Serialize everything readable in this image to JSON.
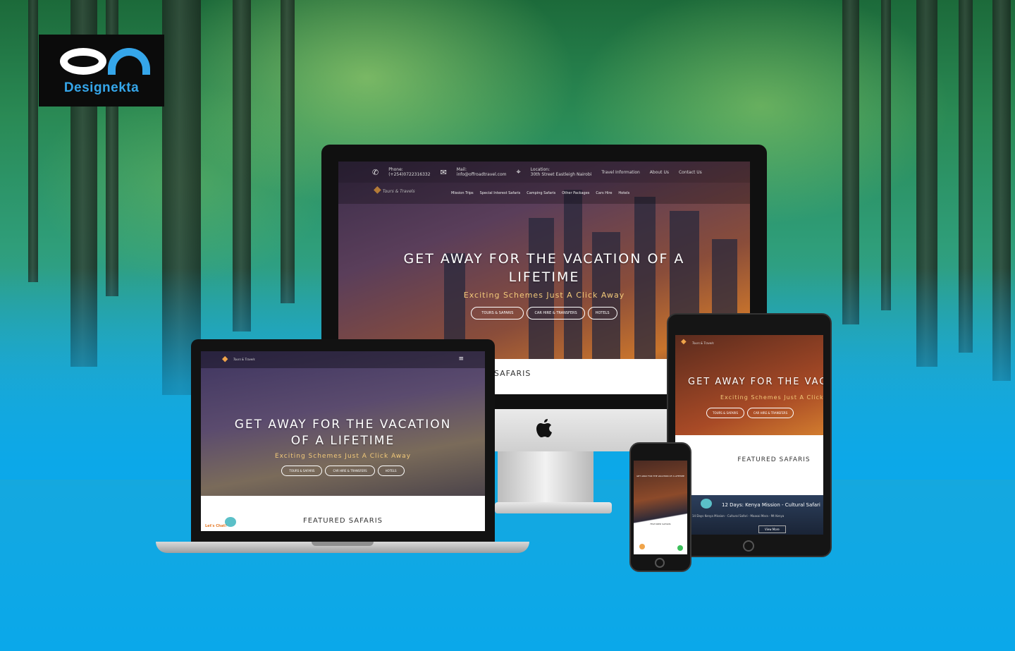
{
  "brand": {
    "logo_text": "Designekta"
  },
  "site": {
    "hero_title": "GET AWAY FOR THE VACATION OF A LIFETIME",
    "hero_subtitle": "Exciting Schemes Just A Click Away",
    "buttons": [
      "TOURS & SAFARIS",
      "CAR HIRE & TRANSFERS",
      "HOTELS"
    ],
    "section_title": "FEATURED SAFARIS",
    "contact": {
      "phone_label": "Phone:",
      "phone_value": "(+254)0722316332",
      "mail_label": "Mail:",
      "mail_value": "info@offroadtravel.com",
      "location_label": "Location:",
      "location_value": "30th Street Eastleigh Nairobi"
    },
    "top_links": [
      "Travel Information",
      "About Us",
      "Contact Us"
    ],
    "nav": [
      "Mission Trips",
      "Special Interest Safaris",
      "Camping Safaris",
      "Other Packages",
      "Cars Hire",
      "Hotels"
    ],
    "brand_tagline": "Tours & Travels",
    "chat_label": "Let's Chat!",
    "tablet_card_title": "12 Days: Kenya Mission - Cultural Safari",
    "tablet_card_sub": "14 Days Kenya Mission - Cultural Safari - Maasai Mara - Mt Kenya",
    "view_more": "View More"
  },
  "colors": {
    "logo_blue": "#35a6ea",
    "accent_gold": "#f2c97a",
    "brand_orange": "#f0a44a"
  }
}
